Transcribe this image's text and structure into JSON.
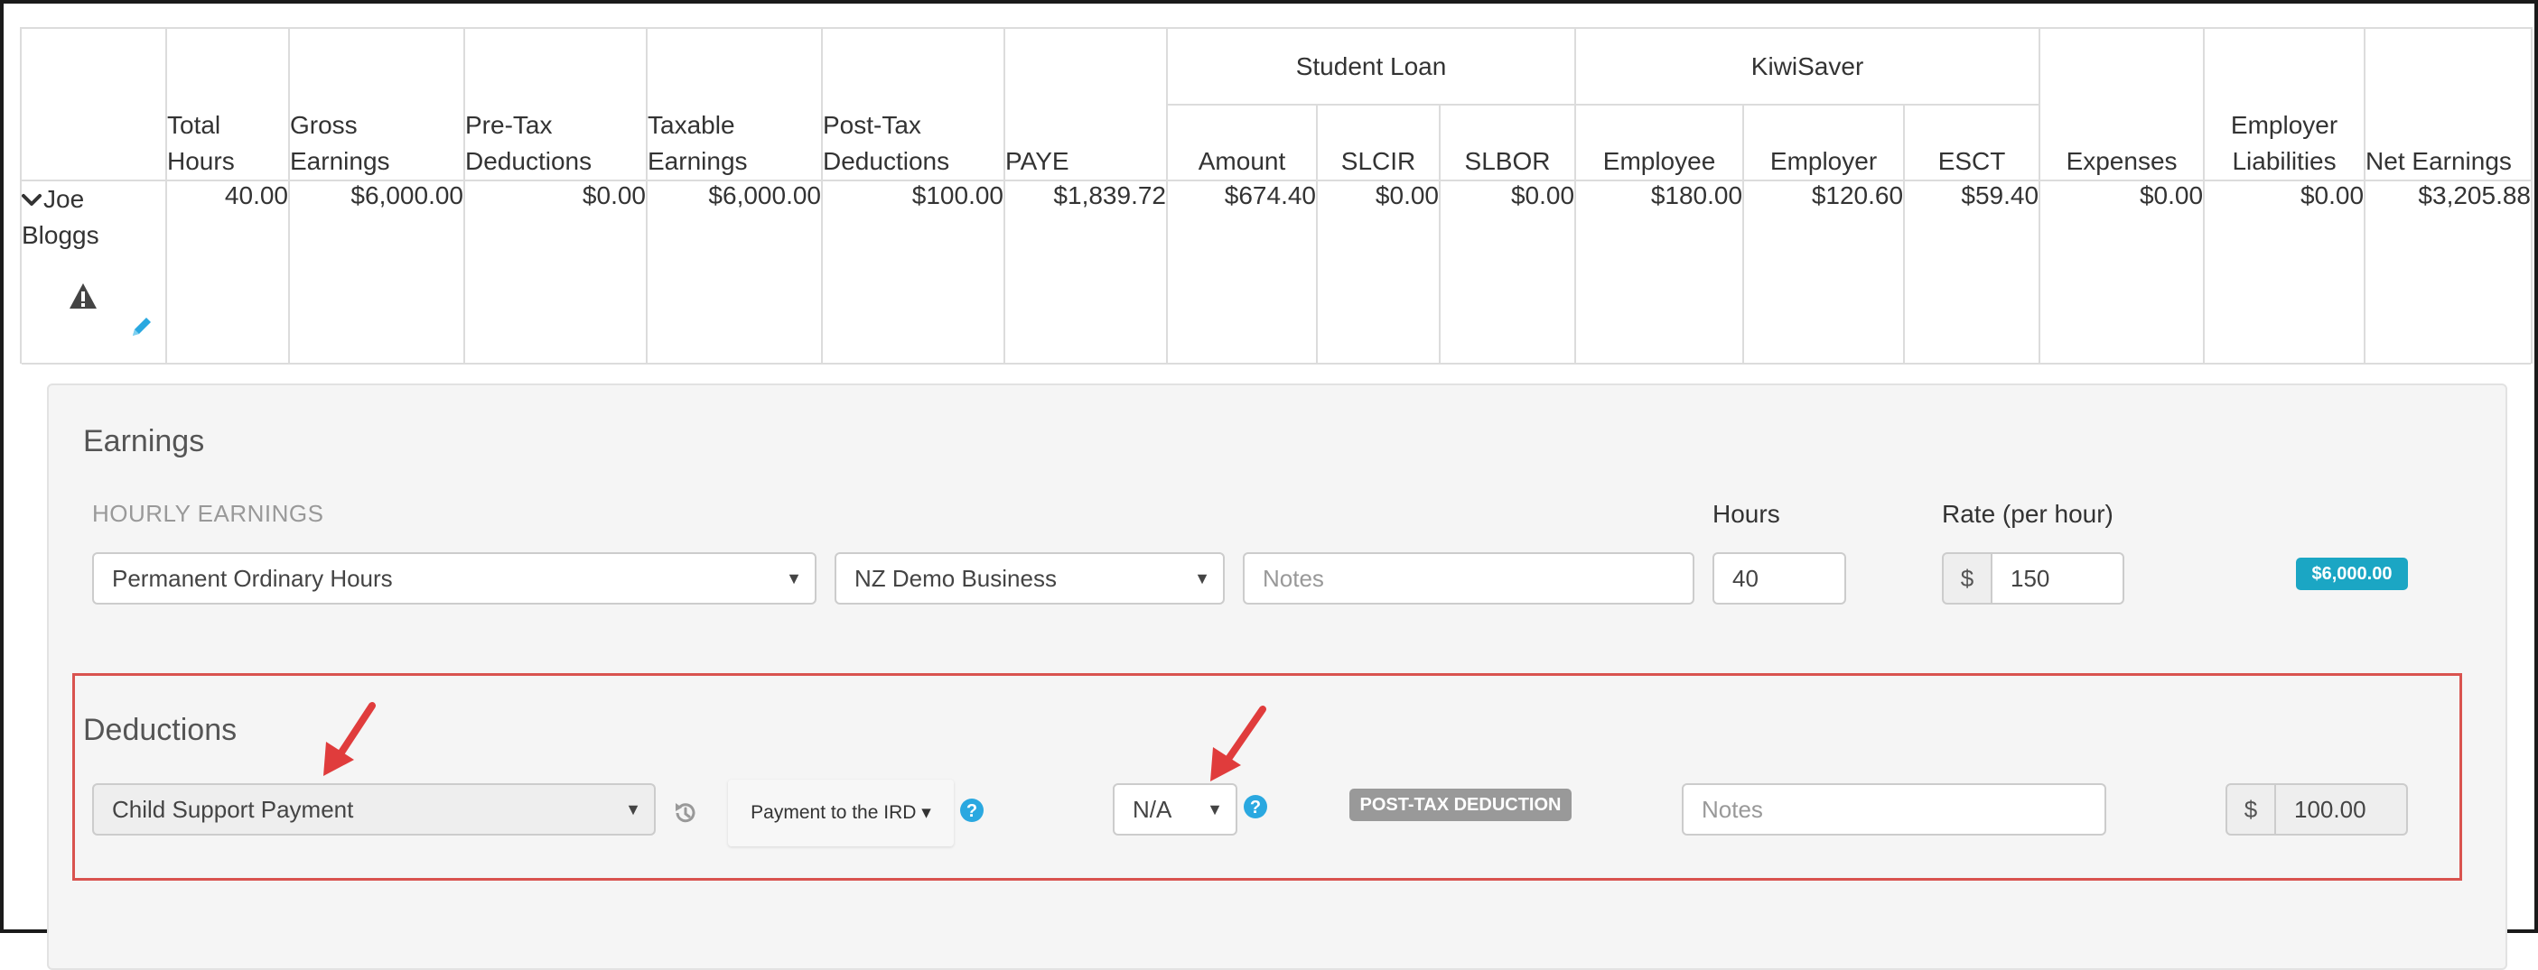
{
  "table": {
    "headers": {
      "total_hours": "Total Hours",
      "gross_earnings": "Gross Earnings",
      "pre_tax_deductions": "Pre-Tax Deductions",
      "taxable_earnings": "Taxable Earnings",
      "post_tax_deductions": "Post-Tax Deductions",
      "paye": "PAYE",
      "student_loan": "Student Loan",
      "student_loan_amount": "Amount",
      "slcir": "SLCIR",
      "slbor": "SLBOR",
      "kiwisaver": "KiwiSaver",
      "kiwisaver_employee": "Employee",
      "kiwisaver_employer": "Employer",
      "esct": "ESCT",
      "expenses": "Expenses",
      "employer_liabilities": "Employer Liabilities",
      "net_earnings": "Net Earnings"
    },
    "row": {
      "employee_name": "Joe Bloggs",
      "total_hours": "40.00",
      "gross_earnings": "$6,000.00",
      "pre_tax_deductions": "$0.00",
      "taxable_earnings": "$6,000.00",
      "post_tax_deductions": "$100.00",
      "paye": "$1,839.72",
      "student_loan_amount": "$674.40",
      "slcir": "$0.00",
      "slbor": "$0.00",
      "kiwisaver_employee": "$180.00",
      "kiwisaver_employer": "$120.60",
      "esct": "$59.40",
      "expenses": "$0.00",
      "employer_liabilities": "$0.00",
      "net_earnings": "$3,205.88"
    }
  },
  "earnings": {
    "title": "Earnings",
    "section_label": "HOURLY EARNINGS",
    "hours_label": "Hours",
    "rate_label": "Rate (per hour)",
    "pay_category": "Permanent Ordinary Hours",
    "business": "NZ Demo Business",
    "notes_placeholder": "Notes",
    "hours_value": "40",
    "currency_symbol": "$",
    "rate_value": "150",
    "total_badge": "$6,000.00"
  },
  "deductions": {
    "title": "Deductions",
    "category": "Child Support Payment",
    "payment_to": "Payment to the IRD",
    "code": "N/A",
    "type_badge": "POST-TAX DEDUCTION",
    "notes_placeholder": "Notes",
    "currency_symbol": "$",
    "amount": "100.00"
  },
  "icons": {
    "expand": "chevron-down-icon",
    "warning": "warning-icon",
    "edit": "pencil-icon",
    "history": "history-icon",
    "help": "question-circle-icon",
    "annotation": "red-arrow-icon"
  },
  "colors": {
    "badge_teal": "#1ba6c4",
    "badge_gray": "#999999",
    "annotation_red": "#e03c3c",
    "help_blue": "#2aa8e0"
  }
}
